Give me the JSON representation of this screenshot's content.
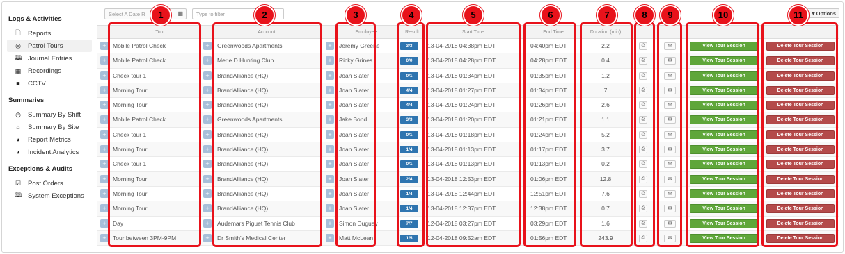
{
  "sidebar": {
    "sections": [
      {
        "title": "Logs & Activities",
        "items": [
          {
            "icon": "document-icon",
            "glyph": "🗋",
            "label": "Reports",
            "active": false
          },
          {
            "icon": "target-icon",
            "glyph": "◎",
            "label": "Patrol Tours",
            "active": true
          },
          {
            "icon": "book-icon",
            "glyph": "🕮",
            "label": "Journal Entries",
            "active": false
          },
          {
            "icon": "film-icon",
            "glyph": "▦",
            "label": "Recordings",
            "active": false
          },
          {
            "icon": "video-camera-icon",
            "glyph": "■",
            "label": "CCTV",
            "active": false
          }
        ]
      },
      {
        "title": "Summaries",
        "items": [
          {
            "icon": "clock-icon",
            "glyph": "◷",
            "label": "Summary By Shift",
            "active": false
          },
          {
            "icon": "home-icon",
            "glyph": "⌂",
            "label": "Summary By Site",
            "active": false
          },
          {
            "icon": "pie-chart-icon",
            "glyph": "◕",
            "label": "Report Metrics",
            "active": false
          },
          {
            "icon": "pie-chart-icon",
            "glyph": "◕",
            "label": "Incident Analytics",
            "active": false
          }
        ]
      },
      {
        "title": "Exceptions & Audits",
        "items": [
          {
            "icon": "checkbox-icon",
            "glyph": "☑",
            "label": "Post Orders",
            "active": false
          },
          {
            "icon": "book-icon",
            "glyph": "🕮",
            "label": "System Exceptions",
            "active": false
          }
        ]
      }
    ]
  },
  "filters": {
    "date_placeholder": "Select A Date R",
    "filter_placeholder": "Type to filter",
    "options_label": "Options"
  },
  "table": {
    "headers": {
      "tour": "Tour",
      "account": "Account",
      "employee": "Employee",
      "result": "Result",
      "start": "Start Time",
      "end": "End Time",
      "duration": "Duration (min)"
    },
    "view_label": "View Tour Session",
    "delete_label": "Delete Tour Session",
    "rows": [
      {
        "tour": "Mobile Patrol Check",
        "account": "Greenwoods Apartments",
        "employee": "Jeremy Greene",
        "result": "3/3",
        "start": "13-04-2018 04:38pm EDT",
        "end": "04:40pm EDT",
        "duration": "2.2"
      },
      {
        "tour": "Mobile Patrol Check",
        "account": "Merle D Hunting Club",
        "employee": "Ricky Grines",
        "result": "0/0",
        "start": "13-04-2018 04:28pm EDT",
        "end": "04:28pm EDT",
        "duration": "0.4"
      },
      {
        "tour": "Check tour 1",
        "account": "BrandAlliance (HQ)",
        "employee": "Joan Slater",
        "result": "0/1",
        "start": "13-04-2018 01:34pm EDT",
        "end": "01:35pm EDT",
        "duration": "1.2"
      },
      {
        "tour": "Morning Tour",
        "account": "BrandAlliance (HQ)",
        "employee": "Joan Slater",
        "result": "4/4",
        "start": "13-04-2018 01:27pm EDT",
        "end": "01:34pm EDT",
        "duration": "7"
      },
      {
        "tour": "Morning Tour",
        "account": "BrandAlliance (HQ)",
        "employee": "Joan Slater",
        "result": "4/4",
        "start": "13-04-2018 01:24pm EDT",
        "end": "01:26pm EDT",
        "duration": "2.6"
      },
      {
        "tour": "Mobile Patrol Check",
        "account": "Greenwoods Apartments",
        "employee": "Jake Bond",
        "result": "3/3",
        "start": "13-04-2018 01:20pm EDT",
        "end": "01:21pm EDT",
        "duration": "1.1"
      },
      {
        "tour": "Check tour 1",
        "account": "BrandAlliance (HQ)",
        "employee": "Joan Slater",
        "result": "0/1",
        "start": "13-04-2018 01:18pm EDT",
        "end": "01:24pm EDT",
        "duration": "5.2"
      },
      {
        "tour": "Morning Tour",
        "account": "BrandAlliance (HQ)",
        "employee": "Joan Slater",
        "result": "1/4",
        "start": "13-04-2018 01:13pm EDT",
        "end": "01:17pm EDT",
        "duration": "3.7"
      },
      {
        "tour": "Check tour 1",
        "account": "BrandAlliance (HQ)",
        "employee": "Joan Slater",
        "result": "0/1",
        "start": "13-04-2018 01:13pm EDT",
        "end": "01:13pm EDT",
        "duration": "0.2"
      },
      {
        "tour": "Morning Tour",
        "account": "BrandAlliance (HQ)",
        "employee": "Joan Slater",
        "result": "2/4",
        "start": "13-04-2018 12:53pm EDT",
        "end": "01:06pm EDT",
        "duration": "12.8"
      },
      {
        "tour": "Morning Tour",
        "account": "BrandAlliance (HQ)",
        "employee": "Joan Slater",
        "result": "1/4",
        "start": "13-04-2018 12:44pm EDT",
        "end": "12:51pm EDT",
        "duration": "7.6"
      },
      {
        "tour": "Morning Tour",
        "account": "BrandAlliance (HQ)",
        "employee": "Joan Slater",
        "result": "1/4",
        "start": "13-04-2018 12:37pm EDT",
        "end": "12:38pm EDT",
        "duration": "0.7"
      },
      {
        "tour": "Day",
        "account": "Audemars Piguet Tennis Club",
        "employee": "Simon Duguay",
        "result": "7/7",
        "start": "12-04-2018 03:27pm EDT",
        "end": "03:29pm EDT",
        "duration": "1.6"
      },
      {
        "tour": "Tour between 3PM-9PM",
        "account": "Dr Smith's Medical Center",
        "employee": "Matt McLean",
        "result": "1/5",
        "start": "12-04-2018 09:52am EDT",
        "end": "01:56pm EDT",
        "duration": "243.9"
      }
    ]
  },
  "annotations": [
    "1",
    "2",
    "3",
    "4",
    "5",
    "6",
    "7",
    "8",
    "9",
    "10",
    "11"
  ],
  "colors": {
    "annotation": "#e8121b",
    "result_badge": "#2f75b0",
    "view_button": "#5fa63a",
    "delete_button": "#b44a4a"
  }
}
